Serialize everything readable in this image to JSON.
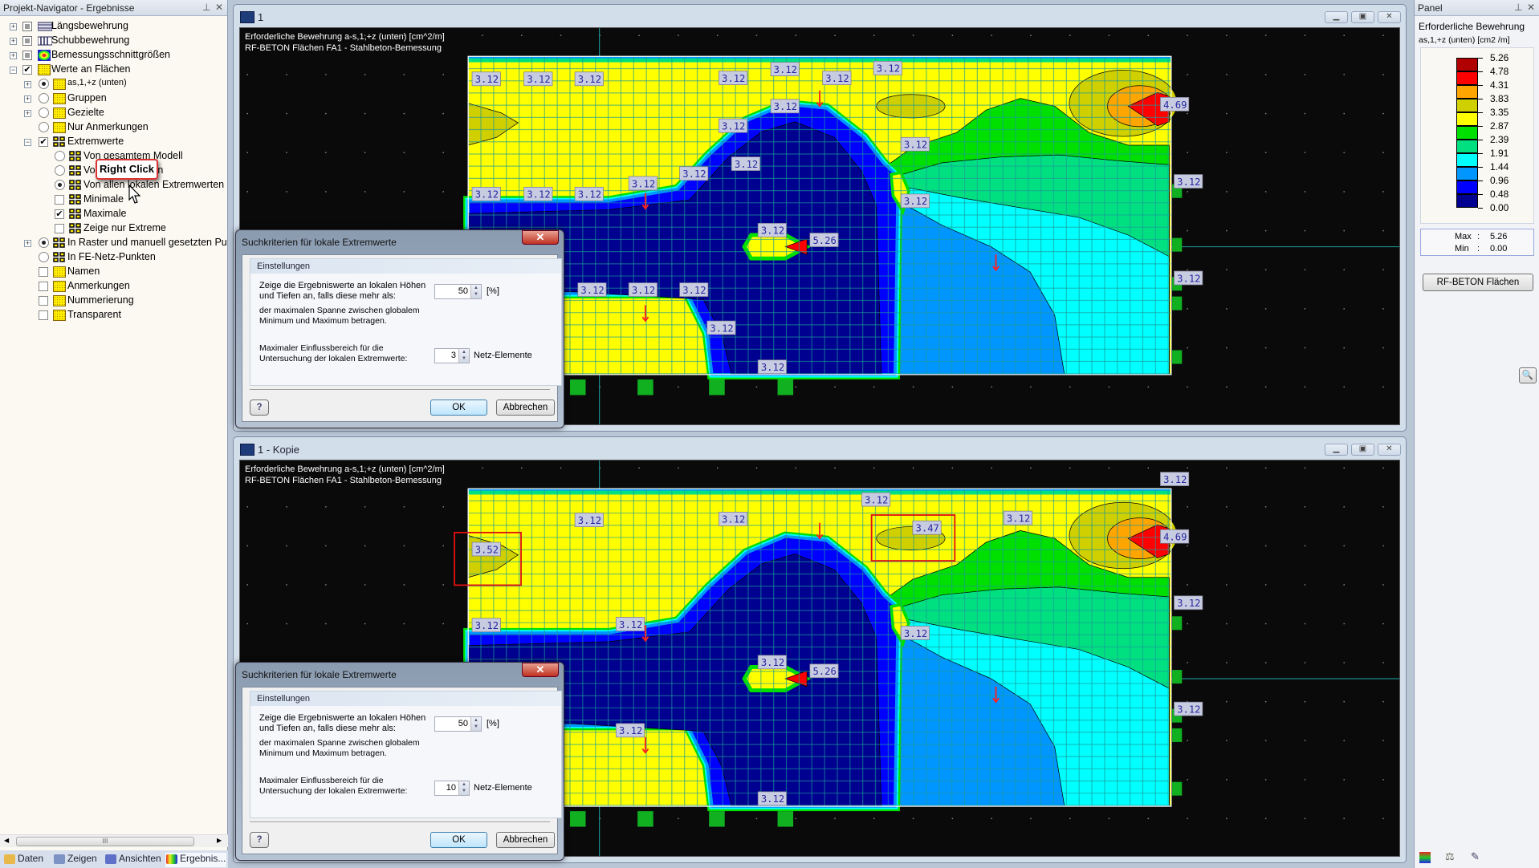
{
  "navigator": {
    "title": "Projekt-Navigator - Ergebnisse",
    "items": [
      {
        "label": "Längsbewehrung",
        "level": 0,
        "expander": "+",
        "control": "checkbox-gray",
        "icon": "longitudinal-reinforcement"
      },
      {
        "label": "Schubbewehrung",
        "level": 0,
        "expander": "+",
        "control": "checkbox-gray",
        "icon": "shear-reinforcement"
      },
      {
        "label": "Bemessungsschnittgrößen",
        "level": 0,
        "expander": "+",
        "control": "checkbox-gray",
        "icon": "design-forces"
      },
      {
        "label": "Werte an Flächen",
        "level": 0,
        "expander": "-",
        "control": "checkbox-checked",
        "icon": "values-yellow"
      },
      {
        "label": "as,1,+z (unten)",
        "level": 1,
        "expander": "+",
        "control": "radio-on",
        "icon": "values-yellow"
      },
      {
        "label": "Gruppen",
        "level": 1,
        "expander": "+",
        "control": "radio-off",
        "icon": "values-yellow"
      },
      {
        "label": "Gezielte",
        "level": 1,
        "expander": "+",
        "control": "radio-off",
        "icon": "values-yellow"
      },
      {
        "label": "Nur Anmerkungen",
        "level": 1,
        "expander": "",
        "control": "radio-off",
        "icon": "values-yellow"
      },
      {
        "label": "Extremwerte",
        "level": 1,
        "expander": "-",
        "control": "checkbox-checked",
        "icon": "extreme-grid"
      },
      {
        "label": "Von gesamtem Modell",
        "level": 2,
        "expander": "",
        "control": "radio-off",
        "icon": "extreme-grid"
      },
      {
        "label": "Von allen Flächen",
        "level": 2,
        "expander": "",
        "control": "radio-off",
        "icon": "extreme-grid"
      },
      {
        "label": "Von allen lokalen Extremwerten",
        "level": 2,
        "expander": "",
        "control": "radio-on",
        "icon": "extreme-grid"
      },
      {
        "label": "Minimale",
        "level": 2,
        "expander": "",
        "control": "checkbox-off",
        "icon": "extreme-grid"
      },
      {
        "label": "Maximale",
        "level": 2,
        "expander": "",
        "control": "checkbox-checked",
        "icon": "extreme-grid"
      },
      {
        "label": "Zeige nur Extreme",
        "level": 2,
        "expander": "",
        "control": "checkbox-off",
        "icon": "extreme-grid"
      },
      {
        "label": "In Raster und manuell gesetzten Punkten",
        "level": 1,
        "expander": "+",
        "control": "radio-on",
        "icon": "extreme-grid"
      },
      {
        "label": "In FE-Netz-Punkten",
        "level": 1,
        "expander": "",
        "control": "radio-off",
        "icon": "extreme-grid"
      },
      {
        "label": "Namen",
        "level": 1,
        "expander": "",
        "control": "checkbox-off",
        "icon": "values-yellow"
      },
      {
        "label": "Anmerkungen",
        "level": 1,
        "expander": "",
        "control": "checkbox-off",
        "icon": "values-yellow"
      },
      {
        "label": "Nummerierung",
        "level": 1,
        "expander": "",
        "control": "checkbox-off",
        "icon": "values-yellow"
      },
      {
        "label": "Transparent",
        "level": 1,
        "expander": "",
        "control": "checkbox-off",
        "icon": "values-yellow"
      }
    ],
    "tooltip": "Right Click",
    "tabs": [
      {
        "label": "Daten",
        "icon": "data-icon"
      },
      {
        "label": "Zeigen",
        "icon": "display-icon"
      },
      {
        "label": "Ansichten",
        "icon": "views-icon"
      },
      {
        "label": "Ergebnis...",
        "icon": "results-icon"
      }
    ]
  },
  "views": [
    {
      "title": "1",
      "header1": "Erforderliche Bewehrung a-s,1,+z (unten) [cm^2/m]",
      "header2": "RF-BETON Flächen FA1 - Stahlbeton-Bemessung",
      "labels": [
        "3.12",
        "3.12",
        "3.12",
        "3.12",
        "3.12",
        "3.12",
        "3.12",
        "3.12",
        "3.12",
        "3.12",
        "3.12",
        "3.12",
        "3.12",
        "3.12",
        "3.12",
        "3.12",
        "3.12",
        "4.69",
        "3.12",
        "3.12",
        "5.26",
        "3.12",
        "3.12",
        "3.12",
        "3.12",
        "3.12",
        "3.12"
      ]
    },
    {
      "title": "1 - Kopie",
      "header1": "Erforderliche Bewehrung a-s,1,+z (unten) [cm^2/m]",
      "header2": "RF-BETON Flächen FA1 - Stahlbeton-Bemessung",
      "labels": [
        "3.12",
        "3.12",
        "3.12",
        "3.12",
        "3.12",
        "3.47",
        "3.52",
        "4.69",
        "3.12",
        "3.12",
        "3.12",
        "3.12",
        "3.12",
        "5.26",
        "3.12",
        "3.12",
        "3.12"
      ]
    }
  ],
  "dialogs": [
    {
      "title": "Suchkriterien für lokale Extremwerte",
      "close": "✕",
      "section": "Einstellungen",
      "line1": "Zeige die Ergebniswerte an lokalen Höhen",
      "line2": "und Tiefen an, falls diese mehr als:",
      "line3": "der maximalen Spanne zwischen globalem",
      "line4": "Minimum und Maximum betragen.",
      "line5": "Maximaler Einflussbereich für die",
      "line6": "Untersuchung der lokalen Extremwerte:",
      "percent_value": "50",
      "percent_unit": "[%]",
      "elements_value": "3",
      "elements_unit": "Netz-Elemente",
      "ok": "OK",
      "cancel": "Abbrechen"
    },
    {
      "title": "Suchkriterien für lokale Extremwerte",
      "close": "✕",
      "section": "Einstellungen",
      "line1": "Zeige die Ergebniswerte an lokalen Höhen",
      "line2": "und Tiefen an, falls diese mehr als:",
      "line3": "der maximalen Spanne zwischen globalem",
      "line4": "Minimum und Maximum betragen.",
      "line5": "Maximaler Einflussbereich für die",
      "line6": "Untersuchung der lokalen Extremwerte:",
      "percent_value": "50",
      "percent_unit": "[%]",
      "elements_value": "10",
      "elements_unit": "Netz-Elemente",
      "ok": "OK",
      "cancel": "Abbrechen"
    }
  ],
  "panel": {
    "title": "Panel",
    "heading": "Erforderliche Bewehrung",
    "quantity": "as,1,+z (unten) [cm2 /m]",
    "legend_values": [
      "5.26",
      "4.78",
      "4.31",
      "3.83",
      "3.35",
      "2.87",
      "2.39",
      "1.91",
      "1.44",
      "0.96",
      "0.48",
      "0.00"
    ],
    "legend_colors": [
      "#b00000",
      "#ff0000",
      "#ffa500",
      "#d0d000",
      "#ffff00",
      "#00e000",
      "#00e080",
      "#00ffff",
      "#0096ff",
      "#0000ff",
      "#000090"
    ],
    "max_label": "Max",
    "max_value": "5.26",
    "min_label": "Min",
    "min_value": "0.00",
    "button": "RF-BETON Flächen"
  }
}
